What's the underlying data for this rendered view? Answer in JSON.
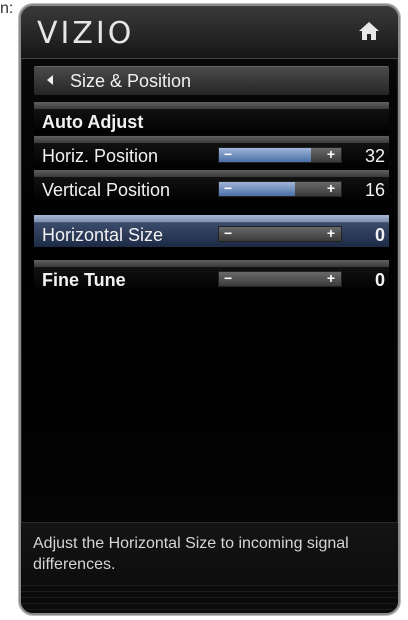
{
  "header": {
    "logo": "VIZIO",
    "home_icon": "home-icon"
  },
  "menu": {
    "title": "Size & Position",
    "back_icon": "back-arrow-icon",
    "items": [
      {
        "label": "Auto Adjust",
        "type": "action",
        "bold": true
      },
      {
        "label": "Horiz. Position",
        "type": "slider",
        "value": "32",
        "level": 0.75,
        "bold": false
      },
      {
        "label": "Vertical Position",
        "type": "slider",
        "value": "16",
        "level": 0.62,
        "bold": false
      },
      {
        "label": "Horizontal Size",
        "type": "slider",
        "value": "0",
        "level": 0.0,
        "bold": false,
        "selected": true
      },
      {
        "label": "Fine Tune",
        "type": "slider",
        "value": "0",
        "level": 0.0,
        "bold": true
      }
    ],
    "slider_minus": "−",
    "slider_plus": "+"
  },
  "help": {
    "text": "Adjust the Horizontal Size to incoming signal differences."
  },
  "colors": {
    "selected_row": "#3b4b6b",
    "slider_fill": "#4a6fa8",
    "background": "#000000"
  }
}
